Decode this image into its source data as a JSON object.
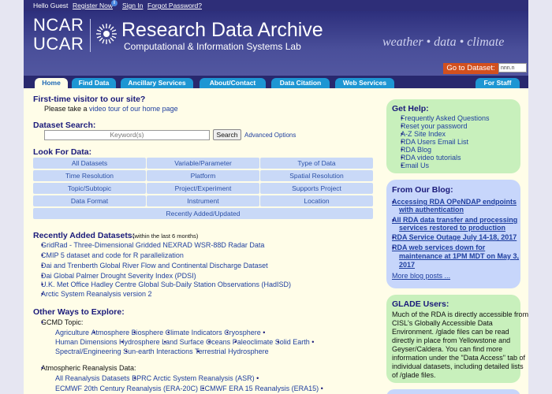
{
  "topbar": {
    "greeting": "Hello Guest",
    "register": "Register Now",
    "info_icon": "i",
    "signin": "Sign In",
    "forgot": "Forgot Password?"
  },
  "header": {
    "ncar": "NCAR",
    "ucar": "UCAR",
    "title": "Research Data Archive",
    "subtitle": "Computational & Information Systems Lab",
    "tagline": "weather • data • climate",
    "goto_label": "Go to Dataset:",
    "goto_placeholder": "nnn.n"
  },
  "nav": {
    "home": "Home",
    "find": "Find Data",
    "ancillary": "Ancillary Services",
    "about": "About/Contact",
    "citation": "Data Citation",
    "web": "Web Services",
    "staff": "For Staff"
  },
  "intro": {
    "heading": "First-time visitor to our site?",
    "text_before": "Please take a ",
    "link": "video tour of our home page"
  },
  "search": {
    "heading": "Dataset Search:",
    "placeholder": "Keyword(s)",
    "button": "Search",
    "advanced": "Advanced Options"
  },
  "look": {
    "heading": "Look For Data:",
    "items": [
      "All Datasets",
      "Variable/Parameter",
      "Type of Data",
      "Time Resolution",
      "Platform",
      "Spatial Resolution",
      "Topic/Subtopic",
      "Project/Experiment",
      "Supports Project",
      "Data Format",
      "Instrument",
      "Location",
      "Recently Added/Updated"
    ]
  },
  "recent": {
    "heading": "Recently Added Datasets:",
    "note": "(within the last 6 months)",
    "items": [
      "GridRad - Three-Dimensional Gridded NEXRAD WSR-88D Radar Data",
      "CMIP 5 dataset and code for R parallelization",
      "Dai and Trenberth Global River Flow and Continental Discharge Dataset",
      "Dai Global Palmer Drought Severity Index (PDSI)",
      "U.K. Met Office Hadley Centre Global Sub-Daily Station Observations (HadISD)",
      "Arctic System Reanalysis version 2"
    ]
  },
  "other": {
    "heading": "Other Ways to Explore:",
    "gcmd_label": "GCMD Topic:",
    "gcmd_row1": [
      "Agriculture",
      "Atmosphere",
      "Biosphere",
      "Climate Indicators",
      "Cryosphere"
    ],
    "gcmd_row2": [
      "Human Dimensions",
      "Hydrosphere",
      "Land Surface",
      "Oceans",
      "Paleoclimate",
      "Solid Earth"
    ],
    "gcmd_row3": [
      "Spectral/Engineering",
      "Sun-earth Interactions",
      "Terrestrial Hydrosphere"
    ],
    "atmos_label": "Atmospheric Reanalysis Data:",
    "atmos_row1": [
      "All Reanalysis Datasets",
      "BPRC Arctic System Reanalysis (ASR)"
    ],
    "atmos_row2": [
      "ECMWF 20th Century Reanalysis (ERA-20C)",
      "ECMWF ERA 15 Reanalysis (ERA15)"
    ]
  },
  "help": {
    "heading": "Get Help:",
    "items": [
      "Frequently Asked Questions",
      "Reset your password",
      "A-Z Site Index",
      "RDA Users Email List",
      "RDA Blog",
      "RDA video tutorials",
      "Email Us"
    ]
  },
  "blog": {
    "heading": "From Our Blog:",
    "items": [
      [
        "Accessing RDA OPeNDAP endpoints",
        "with authentication"
      ],
      [
        "All RDA data transfer and processing",
        "services restored to production"
      ],
      [
        "RDA Service Outage July 14-18, 2017"
      ],
      [
        "RDA web services down for",
        "maintenance at 1PM MDT on May 3,",
        "2017"
      ]
    ],
    "more": "More blog posts ..."
  },
  "glade": {
    "heading": "GLADE Users:",
    "lines": [
      "Much of the RDA is directly accessible from",
      "CISL's Globally Accessible Data",
      "Environment. /glade files can be read",
      "directly in place from Yellowstone and",
      "Geyser/Caldera. You can find more",
      "information under the \"Data Access\" tab of",
      "individual datasets, including detailed lists",
      "of /glade files."
    ]
  },
  "colors": {
    "accent": "#1d96d3",
    "banner": "#2d2f7c",
    "page_bg": "#fffde8",
    "help_box": "#c8f0bc",
    "blog_box": "#c7d6fb",
    "goto": "#d2501e"
  }
}
